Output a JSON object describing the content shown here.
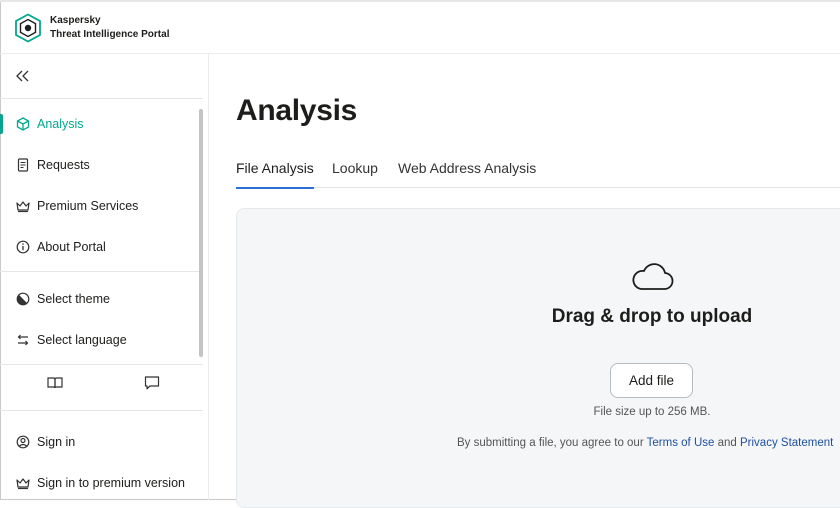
{
  "brand": {
    "line1": "Kaspersky",
    "line2": "Threat Intelligence Portal",
    "accent": "#00a88e"
  },
  "sidebar": {
    "collapse_icon": "double-chevron-left-icon",
    "nav": [
      {
        "label": "Analysis",
        "icon": "cube-icon",
        "active": true
      },
      {
        "label": "Requests",
        "icon": "document-icon"
      },
      {
        "label": "Premium Services",
        "icon": "crown-icon"
      },
      {
        "label": "About Portal",
        "icon": "info-icon"
      }
    ],
    "settings": [
      {
        "label": "Select theme",
        "icon": "theme-icon"
      },
      {
        "label": "Select language",
        "icon": "arrows-swap-icon"
      }
    ],
    "mini_buttons": [
      "book-icon",
      "chat-icon"
    ],
    "account": [
      {
        "label": "Sign in",
        "icon": "user-circle-icon"
      },
      {
        "label": "Sign in to premium version",
        "icon": "crown-icon"
      }
    ]
  },
  "main": {
    "title": "Analysis",
    "tabs": [
      {
        "label": "File Analysis",
        "active": true
      },
      {
        "label": "Lookup"
      },
      {
        "label": "Web Address Analysis"
      }
    ],
    "upload": {
      "icon": "cloud-icon",
      "title": "Drag & drop to upload",
      "button": "Add file",
      "size_note": "File size up to 256 MB.",
      "terms_prefix": "By submitting a file, you agree to our",
      "terms_link": "Terms of Use",
      "terms_and": "and",
      "privacy_link": "Privacy Statement"
    },
    "tab_underline_color": "#2a6fd6"
  }
}
